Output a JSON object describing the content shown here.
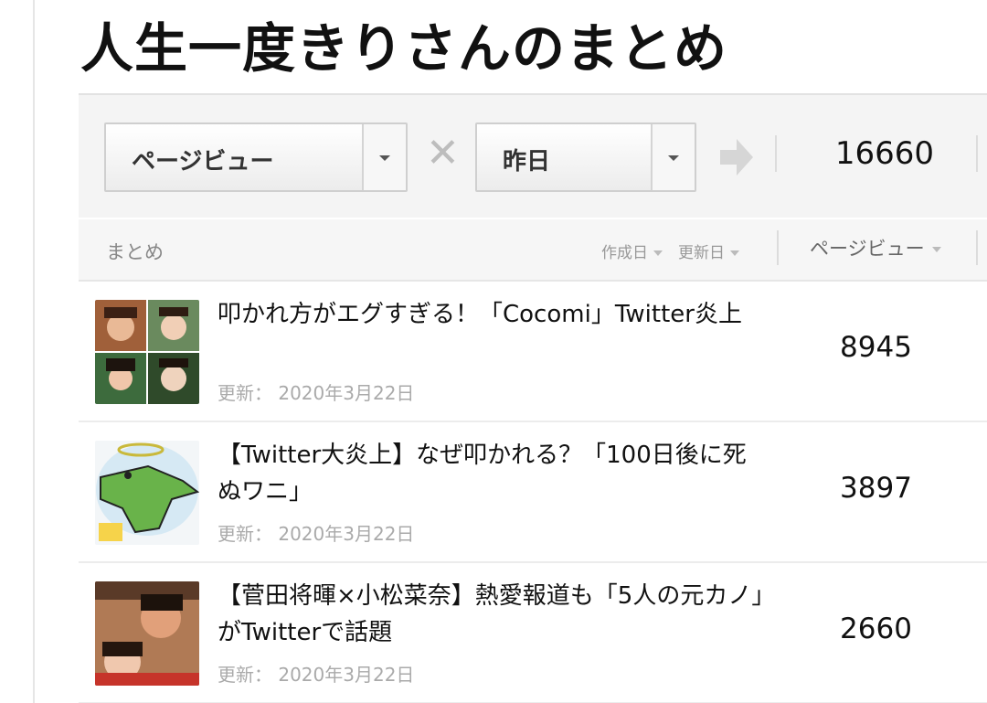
{
  "page": {
    "title": "人生一度きりさんのまとめ"
  },
  "filters": {
    "metric_select": {
      "value": "ページビュー"
    },
    "period_select": {
      "value": "昨日"
    },
    "total": "16660"
  },
  "list_header": {
    "matome_label": "まとめ",
    "created_label": "作成日",
    "updated_label": "更新日",
    "pageview_label": "ページビュー"
  },
  "items": [
    {
      "title": "叩かれ方がエグすぎる！「Cocomi」Twitter炎上",
      "date_prefix": "更新：",
      "date": "2020年3月22日",
      "views": "8945"
    },
    {
      "title": "【Twitter大炎上】なぜ叩かれる？「100日後に死ぬワニ」",
      "date_prefix": "更新：",
      "date": "2020年3月22日",
      "views": "3897"
    },
    {
      "title": "【菅田将暉×小松菜奈】熱愛報道も「5人の元カノ」がTwitterで話題",
      "date_prefix": "更新：",
      "date": "2020年3月22日",
      "views": "2660"
    }
  ],
  "icons": {
    "dropdown": "chevron-down-icon",
    "times": "times-icon",
    "arrow": "arrow-right-icon",
    "sort": "sort-caret-icon"
  },
  "colors": {
    "filter_bar_bg": "#f4f4f4",
    "select_border": "#cfcfcf",
    "muted_text": "#aaaaaa",
    "arrow": "#d6d6d6"
  }
}
